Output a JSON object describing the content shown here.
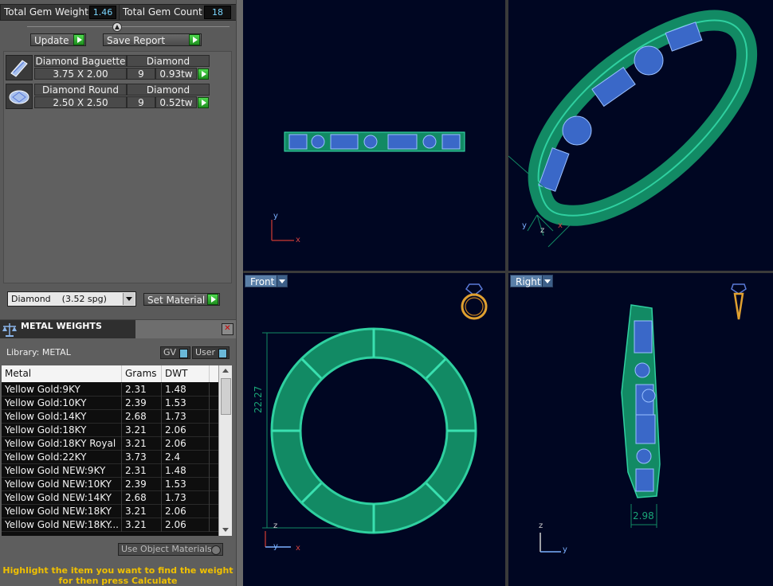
{
  "totals": {
    "weight_label": "Total Gem Weight",
    "weight_value": "1.46",
    "count_label": "Total Gem Count",
    "count_value": "18"
  },
  "actions": {
    "update_label": "Update",
    "save_report_label": "Save Report"
  },
  "gems": [
    {
      "name": "Diamond Baguette",
      "material": "Diamond",
      "size": "3.75 X 2.00",
      "count": "9",
      "weight": "0.93tw",
      "icon": "baguette-gem-icon"
    },
    {
      "name": "Diamond Round",
      "material": "Diamond",
      "size": "2.50 X 2.50",
      "count": "9",
      "weight": "0.52tw",
      "icon": "round-gem-icon"
    }
  ],
  "material": {
    "selected": "Diamond    (3.52 spg)",
    "set_label": "Set Material"
  },
  "metal_weights": {
    "title": "METAL WEIGHTS",
    "library_label": "Library: METAL",
    "gv_label": "GV",
    "user_label": "User",
    "columns": [
      "Metal",
      "Grams",
      "DWT"
    ],
    "rows": [
      [
        "Yellow Gold:9KY",
        "2.31",
        "1.48"
      ],
      [
        "Yellow Gold:10KY",
        "2.39",
        "1.53"
      ],
      [
        "Yellow Gold:14KY",
        "2.68",
        "1.73"
      ],
      [
        "Yellow Gold:18KY",
        "3.21",
        "2.06"
      ],
      [
        "Yellow Gold:18KY Royal",
        "3.21",
        "2.06"
      ],
      [
        "Yellow Gold:22KY",
        "3.73",
        "2.4"
      ],
      [
        "Yellow Gold NEW:9KY",
        "2.31",
        "1.48"
      ],
      [
        "Yellow Gold NEW:10KY",
        "2.39",
        "1.53"
      ],
      [
        "Yellow Gold NEW:14KY",
        "2.68",
        "1.73"
      ],
      [
        "Yellow Gold NEW:18KY",
        "3.21",
        "2.06"
      ],
      [
        "Yellow Gold NEW:18KY...",
        "3.21",
        "2.06"
      ]
    ],
    "use_object_label": "Use Object Materials",
    "hint_line1": "Highlight the item you want to find the weight",
    "hint_line2": "for then press Calculate"
  },
  "viewports": {
    "front_label": "Front",
    "right_label": "Right",
    "front_dimension": "22.27",
    "right_dimension": "2.98",
    "axis_x": "x",
    "axis_y": "y",
    "axis_z": "z"
  },
  "colors": {
    "viewport_bg": "#000622",
    "metal": "#1fa87a",
    "gem": "#4a7ad8",
    "accent_green": "#2fbf2f",
    "hint": "#f0c000"
  }
}
